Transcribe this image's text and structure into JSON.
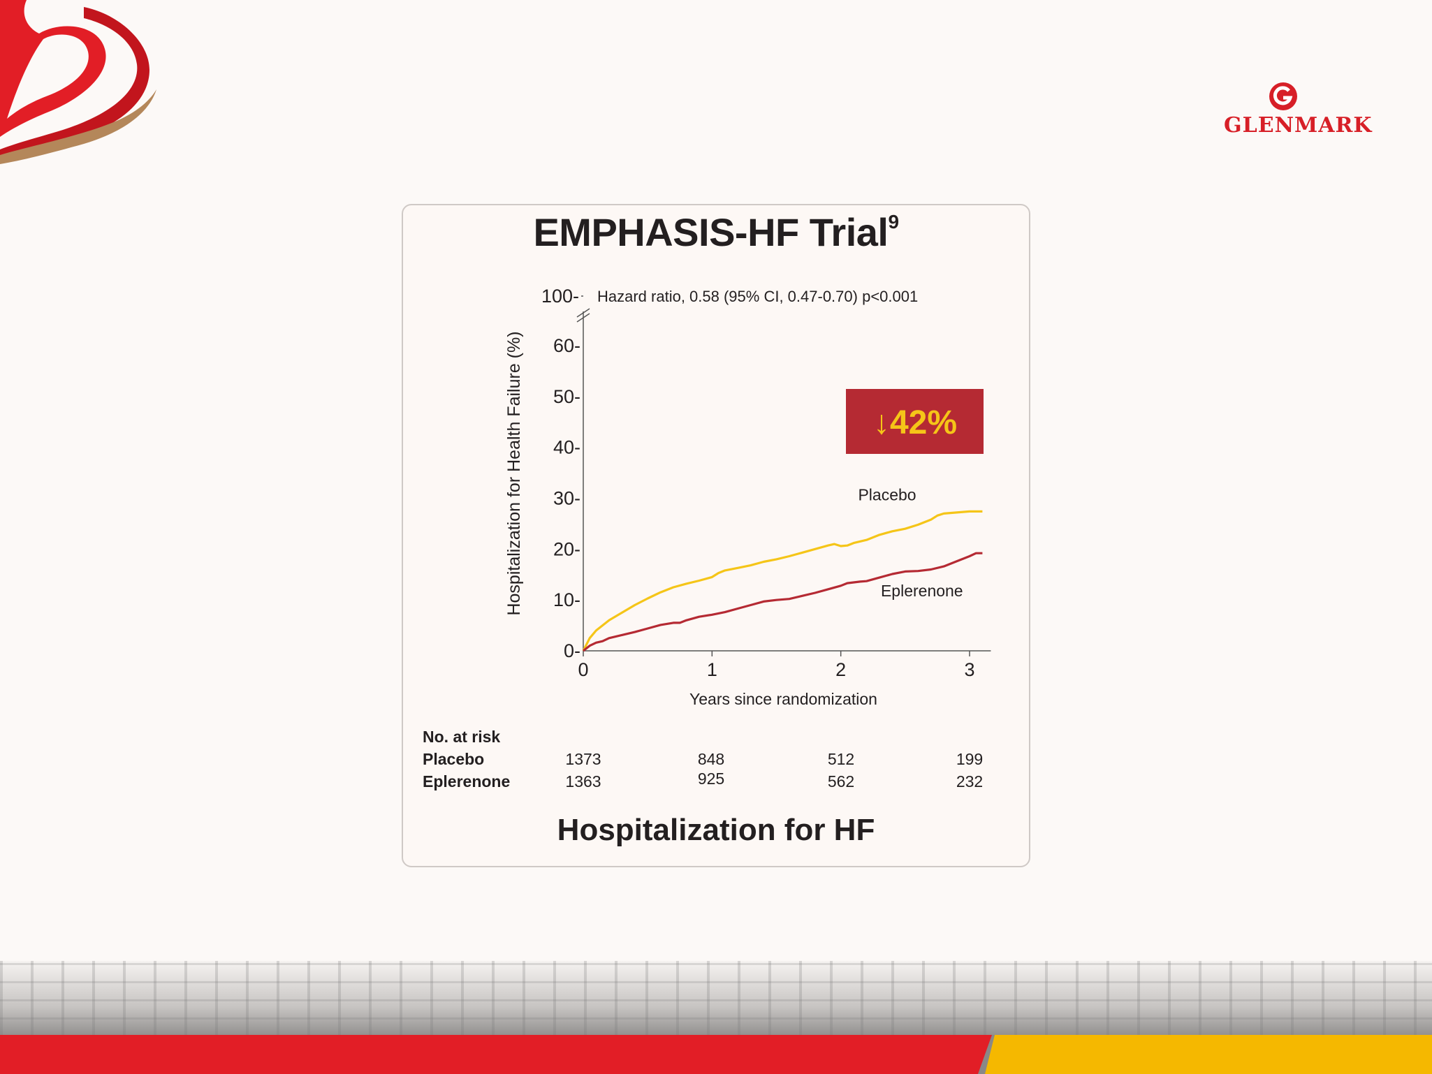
{
  "colors": {
    "placebo": "#f5c518",
    "eplerenone": "#b52a33",
    "badge_bg": "#b52a33",
    "badge_text": "#f5c518",
    "brand_red": "#d71f27"
  },
  "branding": {
    "company": "GLENMARK",
    "corner_logo": "heart-logo"
  },
  "card": {
    "title": "EMPHASIS-HF Trial",
    "title_ref": "9",
    "footer_title": "Hospitalization for HF"
  },
  "risk_table": {
    "header": "No. at risk",
    "rows": [
      {
        "label": "Placebo",
        "values": [
          "1373",
          "848",
          "512",
          "199"
        ]
      },
      {
        "label": "Eplerenone",
        "values": [
          "1363",
          "925",
          "562",
          "232"
        ]
      }
    ]
  },
  "chart_data": {
    "type": "line",
    "title": "EMPHASIS-HF Trial",
    "xlabel": "Years since randomization",
    "ylabel": "Hospitalization for Health Failure (%)",
    "xlim": [
      0,
      3.1
    ],
    "ylim": [
      0,
      65
    ],
    "x_ticks": [
      "0",
      "1",
      "2",
      "3"
    ],
    "y_ticks": [
      "0",
      "10",
      "20",
      "30",
      "40",
      "50",
      "60"
    ],
    "y_break_label": "100",
    "annotation": "Hazard ratio, 0.58 (95% CI, 0.47-0.70) p<0.001",
    "badge": {
      "arrow": "↓",
      "text": "42%"
    },
    "series": [
      {
        "name": "Placebo",
        "x": [
          0,
          0.05,
          0.1,
          0.2,
          0.3,
          0.4,
          0.5,
          0.6,
          0.7,
          0.8,
          0.9,
          1.0,
          1.05,
          1.1,
          1.2,
          1.3,
          1.4,
          1.5,
          1.6,
          1.7,
          1.8,
          1.9,
          1.95,
          2.0,
          2.05,
          2.1,
          2.2,
          2.3,
          2.4,
          2.5,
          2.6,
          2.7,
          2.75,
          2.8,
          2.9,
          3.0,
          3.1
        ],
        "y": [
          0,
          2.5,
          4,
          6,
          7.5,
          9,
          10.3,
          11.5,
          12.5,
          13.2,
          13.8,
          14.5,
          15.3,
          15.8,
          16.3,
          16.8,
          17.5,
          18,
          18.6,
          19.3,
          20,
          20.7,
          21,
          20.6,
          20.7,
          21.2,
          21.8,
          22.8,
          23.5,
          24,
          24.8,
          25.8,
          26.6,
          27,
          27.2,
          27.4,
          27.4
        ]
      },
      {
        "name": "Eplerenone",
        "x": [
          0,
          0.05,
          0.1,
          0.15,
          0.2,
          0.3,
          0.4,
          0.5,
          0.6,
          0.7,
          0.75,
          0.8,
          0.9,
          1.0,
          1.1,
          1.2,
          1.3,
          1.4,
          1.5,
          1.6,
          1.7,
          1.8,
          1.9,
          2.0,
          2.05,
          2.15,
          2.2,
          2.3,
          2.4,
          2.5,
          2.6,
          2.7,
          2.8,
          2.9,
          3.0,
          3.05,
          3.1
        ],
        "y": [
          0,
          1,
          1.6,
          1.9,
          2.5,
          3.1,
          3.7,
          4.4,
          5.1,
          5.5,
          5.5,
          6,
          6.7,
          7.1,
          7.6,
          8.3,
          9,
          9.7,
          10,
          10.2,
          10.8,
          11.4,
          12.1,
          12.8,
          13.3,
          13.6,
          13.7,
          14.4,
          15.1,
          15.6,
          15.7,
          16,
          16.6,
          17.6,
          18.6,
          19.2,
          19.2
        ]
      }
    ]
  }
}
